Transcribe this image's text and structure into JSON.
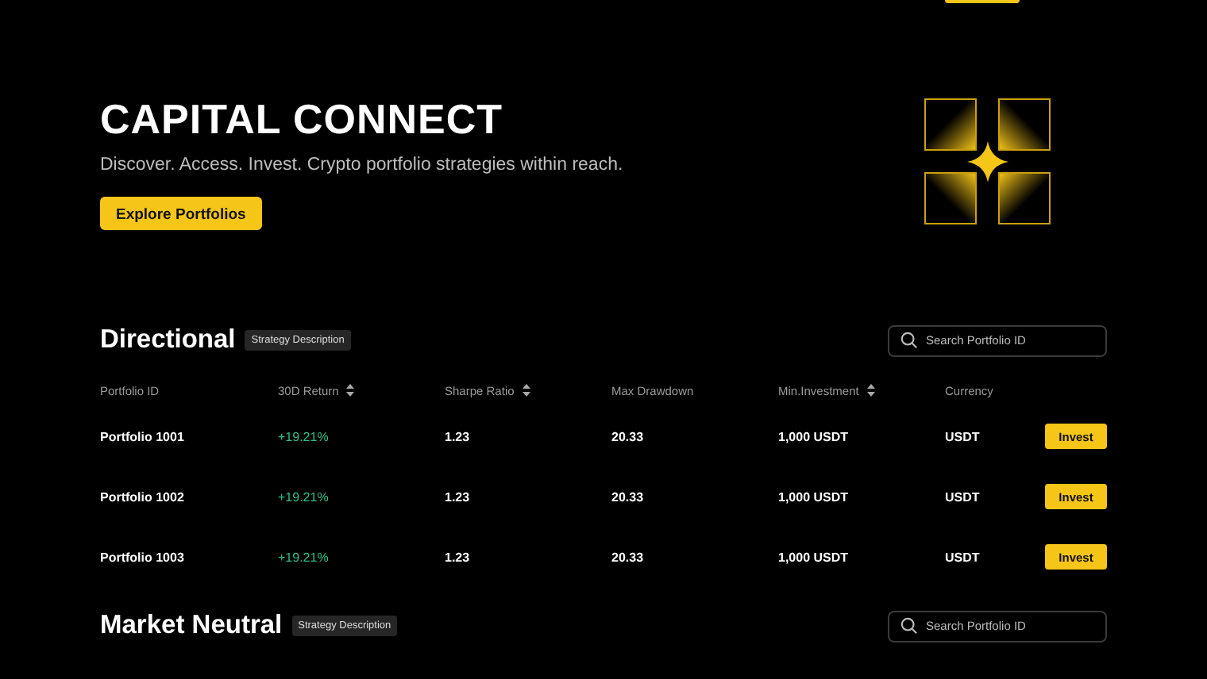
{
  "hero": {
    "title": "CAPITAL CONNECT",
    "subtitle": "Discover. Access. Invest. Crypto portfolio strategies within reach.",
    "button": "Explore Portfolios"
  },
  "sections": [
    {
      "title": "Directional",
      "badge": "Strategy Description",
      "search": {
        "placeholder": "Search Portfolio ID"
      },
      "columns": [
        {
          "label": "Portfolio ID",
          "sortable": false
        },
        {
          "label": "30D Return",
          "sortable": true
        },
        {
          "label": "Sharpe Ratio",
          "sortable": true
        },
        {
          "label": "Max Drawdown",
          "sortable": false
        },
        {
          "label": "Min.Investment",
          "sortable": true
        },
        {
          "label": "Currency",
          "sortable": false
        }
      ],
      "rows": [
        {
          "cells": [
            "Portfolio 1001",
            "+19.21%",
            "1.23",
            "20.33",
            "1,000 USDT",
            "USDT"
          ],
          "action": "Invest"
        },
        {
          "cells": [
            "Portfolio 1002",
            "+19.21%",
            "1.23",
            "20.33",
            "1,000 USDT",
            "USDT"
          ],
          "action": "Invest"
        },
        {
          "cells": [
            "Portfolio 1003",
            "+19.21%",
            "1.23",
            "20.33",
            "1,000 USDT",
            "USDT"
          ],
          "action": "Invest"
        }
      ]
    },
    {
      "title": "Market Neutral",
      "badge": "Strategy Description",
      "search": {
        "placeholder": "Search Portfolio ID"
      }
    }
  ]
}
